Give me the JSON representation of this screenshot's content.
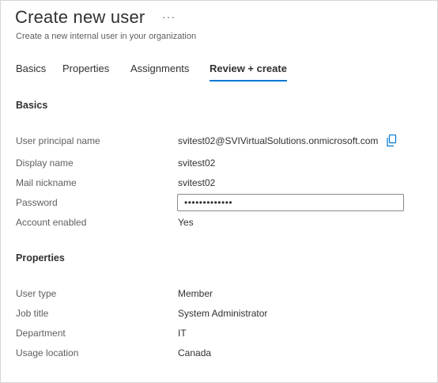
{
  "header": {
    "title": "Create new user",
    "more_icon": "ellipsis-icon",
    "subtitle": "Create a new internal user in your organization"
  },
  "tabs": [
    {
      "label": "Basics",
      "active": false
    },
    {
      "label": "Properties",
      "active": false
    },
    {
      "label": "Assignments",
      "active": false
    },
    {
      "label": "Review + create",
      "active": true
    }
  ],
  "accent_color": "#0078d4",
  "basics": {
    "section_title": "Basics",
    "user_principal_name": {
      "label": "User principal name",
      "value": "svitest02@SVIVirtualSolutions.onmicrosoft.com",
      "copy_icon": "copy-icon"
    },
    "display_name": {
      "label": "Display name",
      "value": "svitest02"
    },
    "mail_nickname": {
      "label": "Mail nickname",
      "value": "svitest02"
    },
    "password": {
      "label": "Password",
      "value": "•••••••••••••"
    },
    "account_enabled": {
      "label": "Account enabled",
      "value": "Yes"
    }
  },
  "properties": {
    "section_title": "Properties",
    "user_type": {
      "label": "User type",
      "value": "Member"
    },
    "job_title": {
      "label": "Job title",
      "value": "System Administrator"
    },
    "department": {
      "label": "Department",
      "value": "IT"
    },
    "usage_location": {
      "label": "Usage location",
      "value": "Canada"
    }
  }
}
